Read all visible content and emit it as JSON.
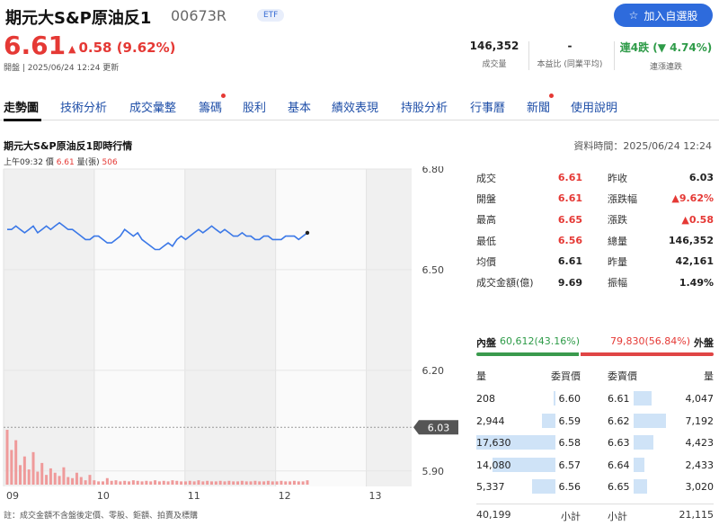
{
  "header": {
    "title": "期元大S&P原油反1",
    "code": "00673R",
    "badge": "ETF",
    "watch_button": "加入自選股",
    "price": "6.61",
    "change": "0.58 (9.62%)",
    "status": "開盤 | 2025/06/24 12:24 更新",
    "stats": [
      {
        "value": "146,352",
        "label": "成交量"
      },
      {
        "value": "-",
        "label": "本益比 (同業平均)"
      },
      {
        "value": "連4跌 (▼ 4.74%)",
        "label": "連漲連跌"
      }
    ]
  },
  "tabs": [
    {
      "label": "走勢圖",
      "active": true,
      "dot": false
    },
    {
      "label": "技術分析",
      "dot": false
    },
    {
      "label": "成交彙整",
      "dot": false
    },
    {
      "label": "籌碼",
      "dot": true
    },
    {
      "label": "股利",
      "dot": false
    },
    {
      "label": "基本",
      "dot": false
    },
    {
      "label": "績效表現",
      "dot": false
    },
    {
      "label": "持股分析",
      "dot": false
    },
    {
      "label": "行事曆",
      "dot": false
    },
    {
      "label": "新聞",
      "dot": true
    },
    {
      "label": "使用說明",
      "dot": false
    }
  ],
  "chart_section": {
    "title": "期元大S&P原油反1即時行情",
    "data_time": "資料時間：2025/06/24 12:24",
    "info_time": "上午09:32",
    "info_price_label": "價",
    "info_price": "6.61",
    "info_vol_label": "量(張)",
    "info_vol": "506",
    "footnote": "註：成交金額不含盤後定價、零股、鉅額、拍賣及標購"
  },
  "chart_data": {
    "type": "line",
    "x_ticks": [
      "09",
      "10",
      "11",
      "12",
      "13"
    ],
    "y_ticks": [
      "6.80",
      "6.50",
      "6.20",
      "5.90"
    ],
    "ylim": [
      5.87,
      6.8
    ],
    "ref_price": "6.03",
    "series": [
      {
        "values": [
          6.62,
          6.62,
          6.63,
          6.62,
          6.61,
          6.62,
          6.63,
          6.61,
          6.62,
          6.63,
          6.62,
          6.63,
          6.64,
          6.63,
          6.62,
          6.62,
          6.61,
          6.6,
          6.59,
          6.59,
          6.6,
          6.6,
          6.59,
          6.58,
          6.58,
          6.59,
          6.6,
          6.62,
          6.61,
          6.6,
          6.61,
          6.59,
          6.58,
          6.57,
          6.56,
          6.56,
          6.57,
          6.58,
          6.57,
          6.59,
          6.6,
          6.59,
          6.6,
          6.61,
          6.62,
          6.61,
          6.62,
          6.63,
          6.62,
          6.61,
          6.62,
          6.61,
          6.6,
          6.6,
          6.61,
          6.6,
          6.6,
          6.59,
          6.59,
          6.6,
          6.6,
          6.59,
          6.59,
          6.59,
          6.6,
          6.6,
          6.6,
          6.59,
          6.6,
          6.61
        ]
      }
    ],
    "volumes": [
      506,
      320,
      410,
      180,
      260,
      140,
      300,
      120,
      200,
      90,
      150,
      110,
      80,
      160,
      70,
      60,
      110,
      70,
      40,
      90,
      40,
      30,
      30,
      60,
      35,
      40,
      30,
      35,
      30,
      40,
      35,
      30,
      35,
      30,
      40,
      30,
      35,
      30,
      40,
      35,
      30,
      30,
      35,
      30,
      40,
      30,
      35,
      30,
      30,
      35,
      30,
      35,
      30,
      30,
      35,
      30,
      30,
      35,
      30,
      30,
      35,
      30,
      30,
      35,
      30,
      30,
      35,
      30,
      30,
      40
    ]
  },
  "quote": [
    {
      "k1": "成交",
      "v1": "6.61",
      "k2": "昨收",
      "v2": "6.03",
      "v1red": true,
      "v2red": false
    },
    {
      "k1": "開盤",
      "v1": "6.61",
      "k2": "漲跌幅",
      "v2": "▲9.62%",
      "v1red": true,
      "v2red": true
    },
    {
      "k1": "最高",
      "v1": "6.65",
      "k2": "漲跌",
      "v2": "▲0.58",
      "v1red": true,
      "v2red": true
    },
    {
      "k1": "最低",
      "v1": "6.56",
      "k2": "總量",
      "v2": "146,352",
      "v1red": true,
      "v2red": false
    },
    {
      "k1": "均價",
      "v1": "6.61",
      "k2": "昨量",
      "v2": "42,161",
      "v1red": false,
      "v2red": false
    },
    {
      "k1": "成交金額(億)",
      "v1": "9.69",
      "k2": "振幅",
      "v2": "1.49%",
      "v1red": false,
      "v2red": false
    }
  ],
  "inout": {
    "in_label": "內盤",
    "in_value": "60,612(43.16%)",
    "out_value": "79,830(56.84%)",
    "out_label": "外盤",
    "in_ratio": 0.4316
  },
  "orderbook": {
    "headers": [
      "量",
      "委買價",
      "委賣價",
      "量"
    ],
    "bids": [
      {
        "vol": "208",
        "price": "6.60",
        "ratio": 0.012
      },
      {
        "vol": "2,944",
        "price": "6.59",
        "ratio": 0.17
      },
      {
        "vol": "17,630",
        "price": "6.58",
        "ratio": 1.0
      },
      {
        "vol": "14,080",
        "price": "6.57",
        "ratio": 0.8
      },
      {
        "vol": "5,337",
        "price": "6.56",
        "ratio": 0.3
      }
    ],
    "asks": [
      {
        "price": "6.61",
        "vol": "4,047",
        "ratio": 0.56
      },
      {
        "price": "6.62",
        "vol": "7,192",
        "ratio": 1.0
      },
      {
        "price": "6.63",
        "vol": "4,423",
        "ratio": 0.61
      },
      {
        "price": "6.64",
        "vol": "2,433",
        "ratio": 0.34
      },
      {
        "price": "6.65",
        "vol": "3,020",
        "ratio": 0.42
      }
    ],
    "bid_total": "40,199",
    "bid_total_label": "小計",
    "ask_total_label": "小計",
    "ask_total": "21,115"
  },
  "colors": {
    "up": "#e53935",
    "down": "#2e9b48",
    "line": "#3b78e7",
    "accent": "#2e6bdc"
  }
}
